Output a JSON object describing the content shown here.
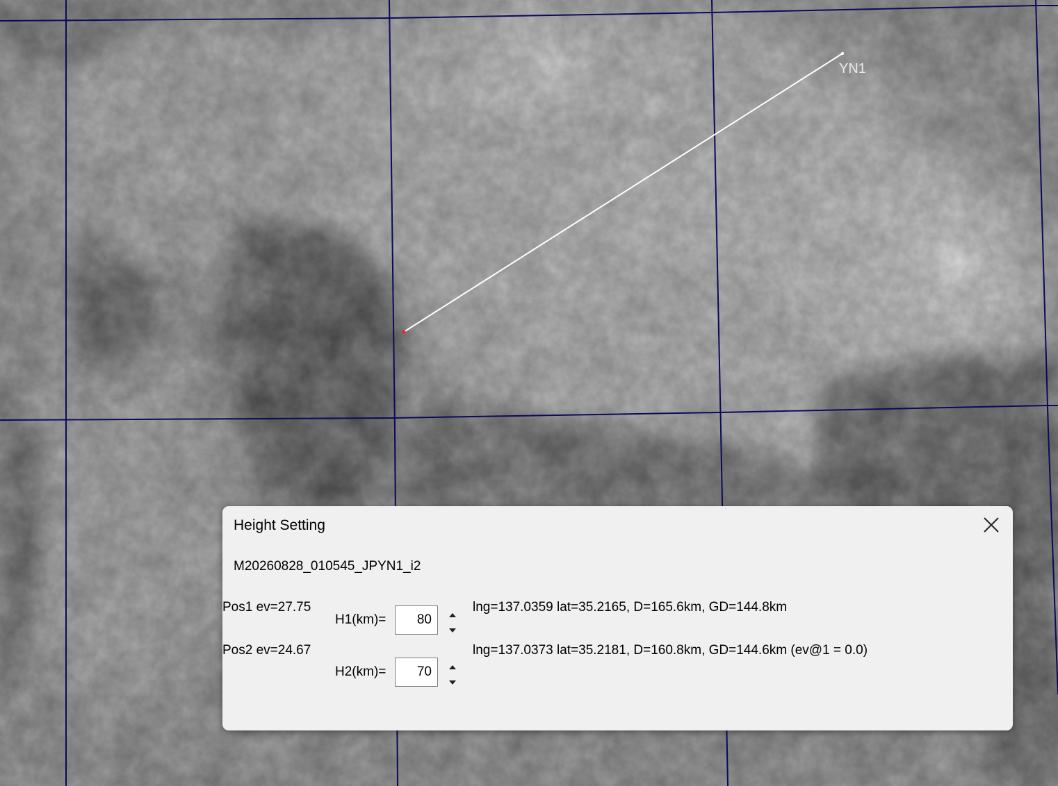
{
  "map": {
    "station_label": "YN1",
    "grid_color": "#0a0a5a",
    "line_color": "#ffffff",
    "marker_color": "#ff2020"
  },
  "dialog": {
    "title": "Height Setting",
    "close_icon": "close-icon",
    "file_name": "M20260828_010545_JPYN1_i2",
    "pos1": {
      "label": "Pos1 ev=27.75",
      "info": "lng=137.0359 lat=35.2165, D=165.6km, GD=144.8km"
    },
    "pos2": {
      "label": "Pos2 ev=24.67",
      "info": "lng=137.0373 lat=35.2181, D=160.8km, GD=144.6km  (ev@1 = 0.0)"
    },
    "h1": {
      "label": "H1(km)=",
      "value": "80",
      "up_icon": "spin-up-icon",
      "down_icon": "spin-down-icon"
    },
    "h2": {
      "label": "H2(km)=",
      "value": "70",
      "up_icon": "spin-up-icon",
      "down_icon": "spin-down-icon"
    }
  }
}
